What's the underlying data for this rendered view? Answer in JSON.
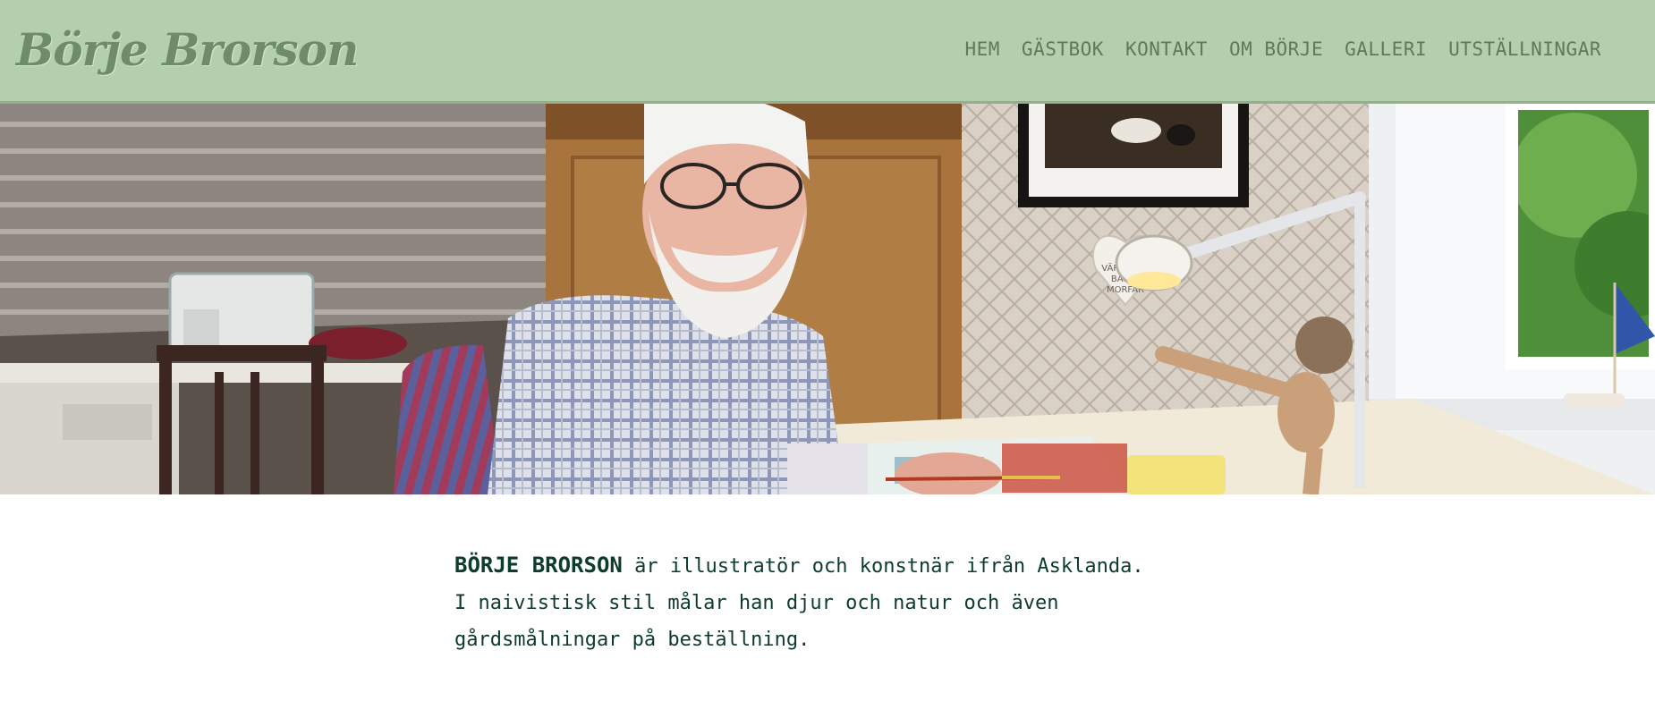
{
  "site": {
    "logo_text": "Börje Brorson"
  },
  "nav": {
    "items": [
      {
        "label": "HEM"
      },
      {
        "label": "GÄSTBOK"
      },
      {
        "label": "KONTAKT"
      },
      {
        "label": "OM BÖRJE"
      },
      {
        "label": "GALLERI"
      },
      {
        "label": "UTSTÄLLNINGAR"
      }
    ]
  },
  "hero": {
    "sign_text": [
      "VÄRLDENS",
      "BÄSTA",
      "MORFAR"
    ]
  },
  "intro": {
    "name": "BÖRJE BRORSON",
    "line1_rest": " är illustratör och konstnär ifrån Asklanda.",
    "line2": "I naivistisk stil målar han djur och natur och även",
    "line3": "gårdsmålningar på beställning."
  },
  "colors": {
    "header_bg": "#b4cfae",
    "logo": "#6f8c68",
    "nav_text": "#5f7a5a",
    "intro_text": "#0d3b2c"
  }
}
